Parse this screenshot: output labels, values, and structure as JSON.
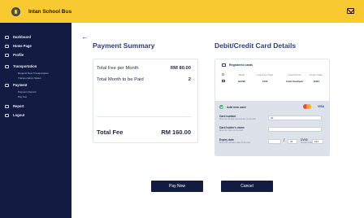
{
  "app": {
    "name": "Intan School Bus"
  },
  "sidebar": {
    "items": [
      {
        "label": "Dashboard"
      },
      {
        "label": "Home Page"
      },
      {
        "label": "Profile"
      },
      {
        "label": "Transportation",
        "subitems": [
          "Request New Transportation",
          "Transportation Status"
        ]
      },
      {
        "label": "Payment",
        "subitems": [
          "Payment Record",
          "Pay Fee"
        ]
      },
      {
        "label": "Report"
      },
      {
        "label": "Logout"
      }
    ]
  },
  "summary": {
    "title": "Payment Summary",
    "rows": [
      {
        "label": "Total Fee per Month",
        "value": "RM 80.00"
      },
      {
        "label": "Total Month to be Paid",
        "value": "2"
      }
    ],
    "total": {
      "label": "Total Fee",
      "value": "RM 160.00"
    }
  },
  "card_details": {
    "title": "Debit/Credit Card Details",
    "registered": {
      "heading": "Registered cards",
      "columns": [
        "",
        "Bank",
        "Last Four Digit",
        "Card Owner",
        "Expiry Date"
      ],
      "rows": [
        {
          "bank": "BANK",
          "last4": "1234",
          "owner": "Fatin Sudliyah",
          "expiry": "12/34"
        }
      ]
    },
    "new_card": {
      "heading": "Add new card",
      "brand_visa": "VISA",
      "card_number": {
        "label": "Card number",
        "hint": "Enter the 16-digit card number on the card",
        "value": "00"
      },
      "holder": {
        "label": "Card holder's name",
        "hint": "Enter the name on the card",
        "value": ""
      },
      "expiry": {
        "label": "Expiry date",
        "hint": "Enter the expiration date of the card",
        "month": "",
        "year": "22"
      },
      "cvv": {
        "label": "CVV2",
        "hint": "Security code",
        "value": "012"
      }
    }
  },
  "actions": {
    "pay": "Pay Now",
    "cancel": "Cancel"
  },
  "colors": {
    "topbar": "#f9c932",
    "sidebar": "#121c42",
    "accent": "#2c3e7a",
    "button": "#121c42"
  }
}
